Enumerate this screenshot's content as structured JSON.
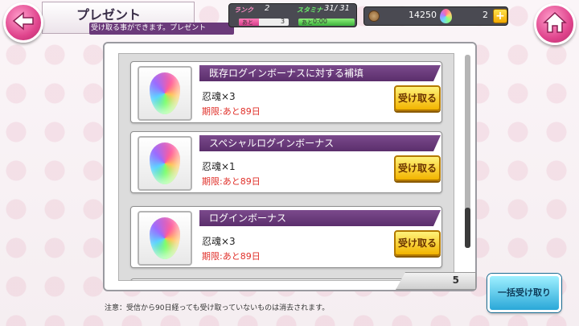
{
  "header": {
    "title": "プレゼント",
    "subtitle": "受け取る事ができます。プレゼント",
    "back_icon": "back-arrow-icon",
    "home_icon": "home-icon"
  },
  "status": {
    "rank_label": "ランク",
    "rank_value": "2",
    "rank_next_label": "あと",
    "rank_next_value": "3",
    "rank_progress": 0.4,
    "stamina_label": "スタミナ",
    "stamina_value": "31/ 31",
    "stamina_next_label": "あと",
    "stamina_time": "0:00",
    "stamina_progress": 1.0
  },
  "currency": {
    "coins": "14250",
    "gems": "2",
    "plus_label": "+"
  },
  "list": {
    "page_count": "5",
    "items": [
      {
        "title": "既存ログインボーナスに対する補填",
        "reward": "忍魂×3",
        "expire": "期限:あと89日",
        "button": "受け取る"
      },
      {
        "title": "スペシャルログインボーナス",
        "reward": "忍魂×1",
        "expire": "期限:あと89日",
        "button": "受け取る"
      },
      {
        "title": "ログインボーナス",
        "reward": "忍魂×3",
        "expire": "期限:あと89日",
        "button": "受け取る"
      }
    ]
  },
  "footer": {
    "bulk_button": "一括受け取り",
    "note": "注意：受信から90日経っても受け取っていないものは消去されます。"
  },
  "colors": {
    "accent_pink": "#e0458d",
    "title_purple": "#5b2e6c",
    "button_yellow": "#f2b400",
    "expire_red": "#e0302a",
    "bulk_blue": "#2aa8d8"
  }
}
